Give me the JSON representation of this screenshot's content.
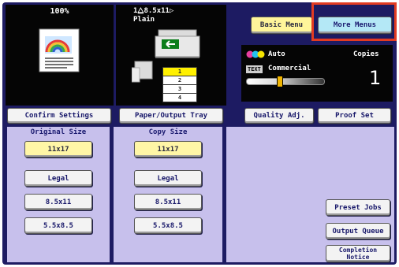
{
  "original_panel": {
    "top_label": "100%"
  },
  "copy_panel": {
    "paper_label": "1⧋8.5x11▷",
    "paper_type": "Plain"
  },
  "tray_numbers": [
    "1",
    "2",
    "3",
    "4"
  ],
  "header_buttons": {
    "basic_menu": "Basic Menu",
    "more_menus": "More Menus"
  },
  "status": {
    "color_mode": "Auto",
    "mode_badge": "TEXT",
    "document_type": "Commercial",
    "copies_label": "Copies",
    "copies_value": "1"
  },
  "buttons": {
    "confirm_settings": "Confirm Settings",
    "paper_output_tray": "Paper/Output Tray",
    "quality_adj": "Quality Adj.",
    "proof_set": "Proof Set",
    "preset_jobs": "Preset Jobs",
    "output_queue": "Output Queue",
    "completion_notice": "Completion Notice"
  },
  "original_size": {
    "title": "Original Size",
    "options": [
      "11x17",
      "Legal",
      "8.5x11",
      "5.5x8.5"
    ],
    "selected": "11x17"
  },
  "copy_size": {
    "title": "Copy Size",
    "options": [
      "11x17",
      "Legal",
      "8.5x11",
      "5.5x8.5"
    ],
    "selected": "11x17"
  },
  "colors": {
    "screen_bg": "#1d1b62",
    "panel_bg": "#c7c0ec",
    "selected_bg": "#fff59a",
    "highlight": "#e23b22"
  }
}
